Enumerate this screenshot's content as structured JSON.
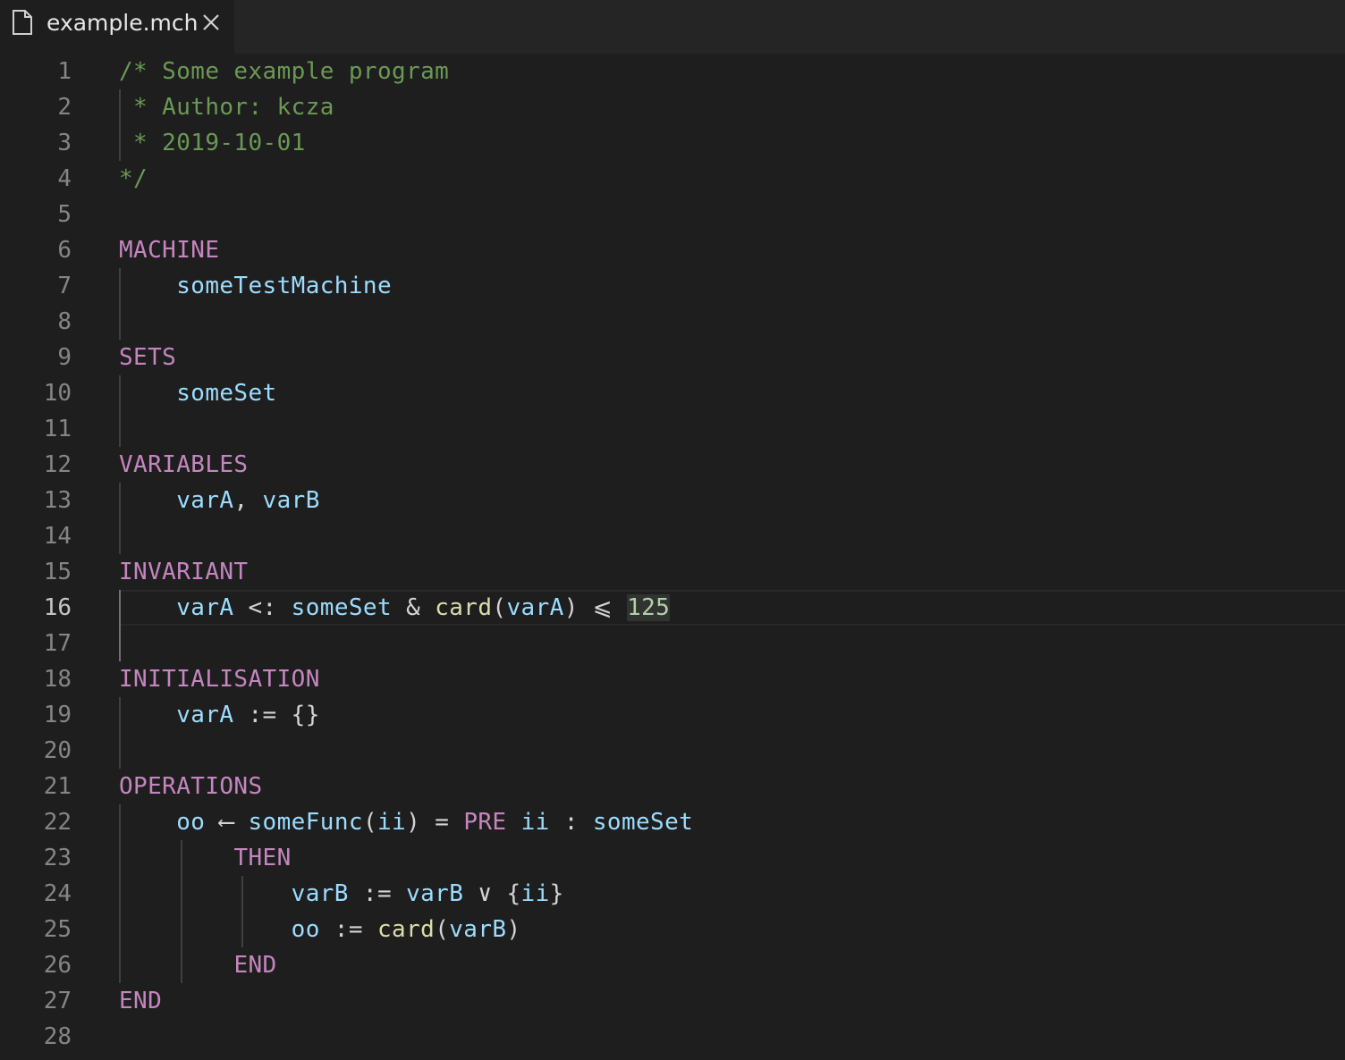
{
  "tab": {
    "file_name": "example.mch",
    "icons": [
      "file-icon",
      "close-icon"
    ]
  },
  "editor": {
    "current_line": 16,
    "colors": {
      "background": "#1e1e1e",
      "keyword": "#c586c0",
      "identifier": "#9cdcfe",
      "function": "#dcdcaa",
      "comment": "#6a9955",
      "number": "#b5cea8",
      "line_number": "#858585"
    },
    "lines": [
      {
        "n": "1",
        "tokens": [
          {
            "t": "/* Some example program",
            "c": "cm"
          }
        ]
      },
      {
        "n": "2",
        "tokens": [
          {
            "t": " * Author: kcza",
            "c": "cm"
          }
        ]
      },
      {
        "n": "3",
        "tokens": [
          {
            "t": " * 2019-10-01",
            "c": "cm"
          }
        ]
      },
      {
        "n": "4",
        "tokens": [
          {
            "t": "*/",
            "c": "cm"
          }
        ]
      },
      {
        "n": "5",
        "tokens": []
      },
      {
        "n": "6",
        "tokens": [
          {
            "t": "MACHINE",
            "c": "kw"
          }
        ]
      },
      {
        "n": "7",
        "tokens": [
          {
            "t": "    ",
            "c": "op"
          },
          {
            "t": "someTestMachine",
            "c": "id"
          }
        ]
      },
      {
        "n": "8",
        "tokens": []
      },
      {
        "n": "9",
        "tokens": [
          {
            "t": "SETS",
            "c": "kw"
          }
        ]
      },
      {
        "n": "10",
        "tokens": [
          {
            "t": "    ",
            "c": "op"
          },
          {
            "t": "someSet",
            "c": "id"
          }
        ]
      },
      {
        "n": "11",
        "tokens": []
      },
      {
        "n": "12",
        "tokens": [
          {
            "t": "VARIABLES",
            "c": "kw"
          }
        ]
      },
      {
        "n": "13",
        "tokens": [
          {
            "t": "    ",
            "c": "op"
          },
          {
            "t": "varA",
            "c": "id"
          },
          {
            "t": ", ",
            "c": "op"
          },
          {
            "t": "varB",
            "c": "id"
          }
        ]
      },
      {
        "n": "14",
        "tokens": []
      },
      {
        "n": "15",
        "tokens": [
          {
            "t": "INVARIANT",
            "c": "kw"
          }
        ]
      },
      {
        "n": "16",
        "tokens": [
          {
            "t": "    ",
            "c": "op"
          },
          {
            "t": "varA",
            "c": "id"
          },
          {
            "t": " <: ",
            "c": "op"
          },
          {
            "t": "someSet",
            "c": "id"
          },
          {
            "t": " & ",
            "c": "op"
          },
          {
            "t": "card",
            "c": "fn"
          },
          {
            "t": "(",
            "c": "op"
          },
          {
            "t": "varA",
            "c": "id"
          },
          {
            "t": ") ⩽ ",
            "c": "op"
          },
          {
            "t": "125",
            "c": "num"
          }
        ]
      },
      {
        "n": "17",
        "tokens": []
      },
      {
        "n": "18",
        "tokens": [
          {
            "t": "INITIALISATION",
            "c": "kw"
          }
        ]
      },
      {
        "n": "19",
        "tokens": [
          {
            "t": "    ",
            "c": "op"
          },
          {
            "t": "varA",
            "c": "id"
          },
          {
            "t": " := {}",
            "c": "op"
          }
        ]
      },
      {
        "n": "20",
        "tokens": []
      },
      {
        "n": "21",
        "tokens": [
          {
            "t": "OPERATIONS",
            "c": "kw"
          }
        ]
      },
      {
        "n": "22",
        "tokens": [
          {
            "t": "    ",
            "c": "op"
          },
          {
            "t": "oo",
            "c": "id"
          },
          {
            "t": " ⟵ ",
            "c": "op"
          },
          {
            "t": "someFunc",
            "c": "id"
          },
          {
            "t": "(",
            "c": "op"
          },
          {
            "t": "ii",
            "c": "id"
          },
          {
            "t": ") = ",
            "c": "op"
          },
          {
            "t": "PRE",
            "c": "kw"
          },
          {
            "t": " ",
            "c": "op"
          },
          {
            "t": "ii",
            "c": "id"
          },
          {
            "t": " : ",
            "c": "op"
          },
          {
            "t": "someSet",
            "c": "id"
          }
        ]
      },
      {
        "n": "23",
        "tokens": [
          {
            "t": "        ",
            "c": "op"
          },
          {
            "t": "THEN",
            "c": "kw"
          }
        ]
      },
      {
        "n": "24",
        "tokens": [
          {
            "t": "            ",
            "c": "op"
          },
          {
            "t": "varB",
            "c": "id"
          },
          {
            "t": " := ",
            "c": "op"
          },
          {
            "t": "varB",
            "c": "id"
          },
          {
            "t": " ∨ {",
            "c": "op"
          },
          {
            "t": "ii",
            "c": "id"
          },
          {
            "t": "}",
            "c": "op"
          }
        ]
      },
      {
        "n": "25",
        "tokens": [
          {
            "t": "            ",
            "c": "op"
          },
          {
            "t": "oo",
            "c": "id"
          },
          {
            "t": " := ",
            "c": "op"
          },
          {
            "t": "card",
            "c": "fn"
          },
          {
            "t": "(",
            "c": "op"
          },
          {
            "t": "varB",
            "c": "id"
          },
          {
            "t": ")",
            "c": "op"
          }
        ]
      },
      {
        "n": "26",
        "tokens": [
          {
            "t": "        ",
            "c": "op"
          },
          {
            "t": "END",
            "c": "kw"
          }
        ]
      },
      {
        "n": "27",
        "tokens": [
          {
            "t": "END",
            "c": "kw"
          }
        ]
      },
      {
        "n": "28",
        "tokens": []
      }
    ]
  }
}
